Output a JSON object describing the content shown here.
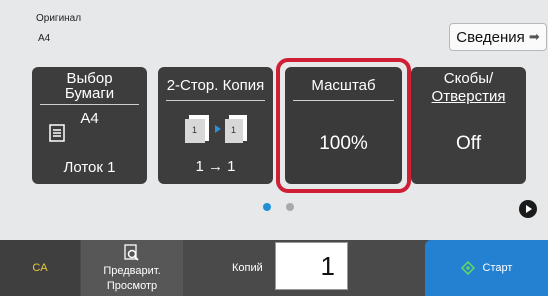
{
  "original": {
    "label": "Оригинал",
    "size": "A4"
  },
  "info_button": {
    "label": "Сведения",
    "icon": "arrow-right-icon"
  },
  "tiles": {
    "paper": {
      "title_line1": "Выбор",
      "title_line2": "Бумаги",
      "size": "A4",
      "tray": "Лоток 1",
      "icon": "paper-tray-icon"
    },
    "duplex": {
      "title": "2-Стор. Копия",
      "mode": "1 → 1",
      "icon": "duplex-pages-icon"
    },
    "zoom": {
      "title": "Масштаб",
      "value": "100%"
    },
    "staple": {
      "title_line1": "Скобы/",
      "title_line2": "Отверстия",
      "value": "Off"
    }
  },
  "pagination": {
    "active_page": 1,
    "page_count": 2
  },
  "bottom": {
    "ca": "CA",
    "preview_line1": "Предварит.",
    "preview_line2": "Просмотр",
    "copies_label": "Копий",
    "copies_value": "1",
    "start": "Старт"
  },
  "colors": {
    "selection": "#d01e35",
    "accent": "#1f8fd9",
    "start": "#2480d0",
    "ca_text": "#e7cb3c",
    "tile": "#3d3d3d"
  }
}
